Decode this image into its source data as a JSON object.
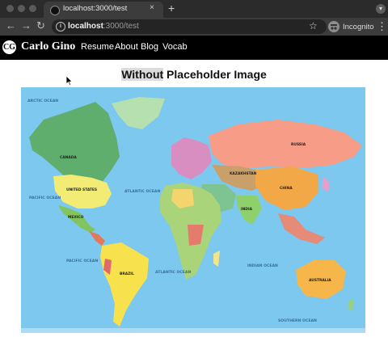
{
  "browser": {
    "tab_title": "localhost:3000/test",
    "tab_close": "×",
    "new_tab": "+",
    "url_host": "localhost",
    "url_rest": ":3000/test",
    "profile_label": "Incognito"
  },
  "site": {
    "logo_text": "CG",
    "brand": "Carlo Gino",
    "nav": [
      "Resume",
      "About",
      "Blog",
      "Vocab"
    ]
  },
  "content": {
    "heading_highlight": "Without",
    "heading_rest": " Placeholder Image"
  },
  "map": {
    "ocean_labels": [
      "ARCTIC OCEAN",
      "PACIFIC OCEAN",
      "ATLANTIC OCEAN",
      "PACIFIC OCEAN",
      "ATLANTIC OCEAN",
      "INDIAN OCEAN",
      "SOUTHERN OCEAN"
    ],
    "country_labels": [
      "CANADA",
      "UNITED STATES",
      "MEXICO",
      "BRAZIL",
      "RUSSIA",
      "CHINA",
      "KAZAKHSTAN",
      "INDIA",
      "AUSTRALIA"
    ]
  },
  "colors": {
    "ocean": "#7cc8ef",
    "nav_bg": "#000000",
    "browser_bg": "#3c3c3c"
  }
}
